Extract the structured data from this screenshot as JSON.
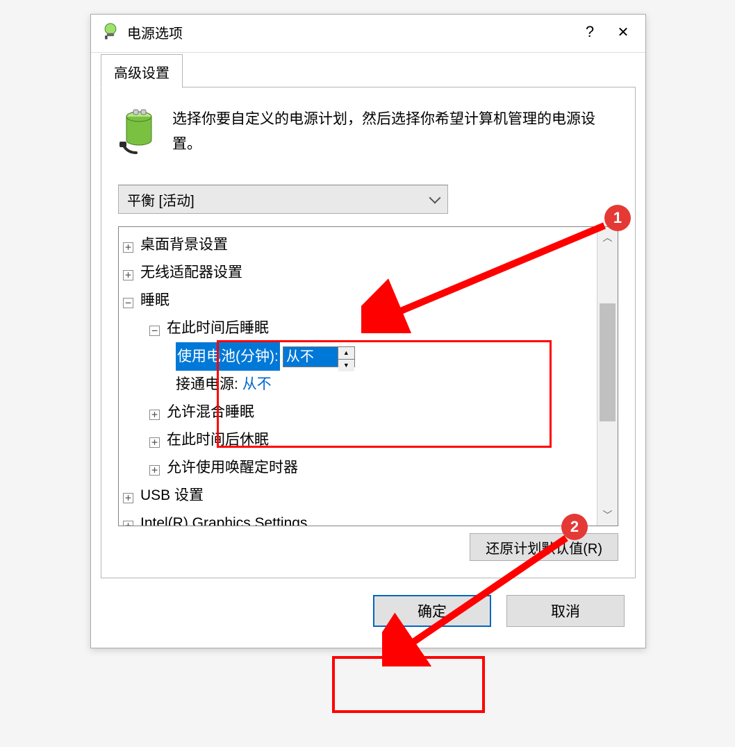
{
  "titlebar": {
    "title": "电源选项",
    "help": "?",
    "close": "✕"
  },
  "tab": {
    "label": "高级设置"
  },
  "intro": {
    "text": "选择你要自定义的电源计划，然后选择你希望计算机管理的电源设置。"
  },
  "plan_select": {
    "label": "平衡 [活动]"
  },
  "tree": {
    "desktop_bg": "桌面背景设置",
    "wireless": "无线适配器设置",
    "sleep": "睡眠",
    "sleep_after": "在此时间后睡眠",
    "battery_label": "使用电池(分钟):",
    "battery_value": "从不",
    "plugged_label": "接通电源:",
    "plugged_value": "从不",
    "hybrid_sleep": "允许混合睡眠",
    "hibernate_after": "在此时间后休眠",
    "wake_timers": "允许使用唤醒定时器",
    "usb": "USB 设置",
    "intel_gfx": "Intel(R) Graphics Settings"
  },
  "buttons": {
    "restore": "还原计划默认值(R)",
    "ok": "确定",
    "cancel": "取消"
  },
  "annotations": {
    "badge1": "1",
    "badge2": "2"
  }
}
